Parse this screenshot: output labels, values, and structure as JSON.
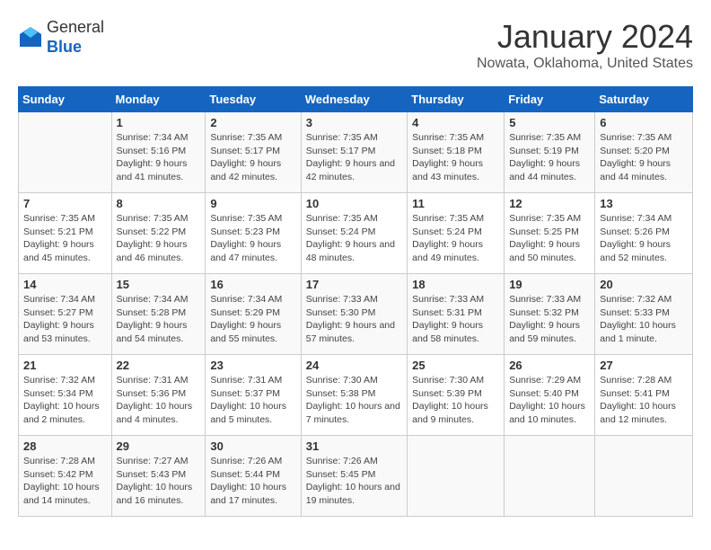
{
  "logo": {
    "general": "General",
    "blue": "Blue"
  },
  "title": "January 2024",
  "subtitle": "Nowata, Oklahoma, United States",
  "weekdays": [
    "Sunday",
    "Monday",
    "Tuesday",
    "Wednesday",
    "Thursday",
    "Friday",
    "Saturday"
  ],
  "weeks": [
    [
      {
        "day": "",
        "sunrise": "",
        "sunset": "",
        "daylight": ""
      },
      {
        "day": "1",
        "sunrise": "Sunrise: 7:34 AM",
        "sunset": "Sunset: 5:16 PM",
        "daylight": "Daylight: 9 hours and 41 minutes."
      },
      {
        "day": "2",
        "sunrise": "Sunrise: 7:35 AM",
        "sunset": "Sunset: 5:17 PM",
        "daylight": "Daylight: 9 hours and 42 minutes."
      },
      {
        "day": "3",
        "sunrise": "Sunrise: 7:35 AM",
        "sunset": "Sunset: 5:17 PM",
        "daylight": "Daylight: 9 hours and 42 minutes."
      },
      {
        "day": "4",
        "sunrise": "Sunrise: 7:35 AM",
        "sunset": "Sunset: 5:18 PM",
        "daylight": "Daylight: 9 hours and 43 minutes."
      },
      {
        "day": "5",
        "sunrise": "Sunrise: 7:35 AM",
        "sunset": "Sunset: 5:19 PM",
        "daylight": "Daylight: 9 hours and 44 minutes."
      },
      {
        "day": "6",
        "sunrise": "Sunrise: 7:35 AM",
        "sunset": "Sunset: 5:20 PM",
        "daylight": "Daylight: 9 hours and 44 minutes."
      }
    ],
    [
      {
        "day": "7",
        "sunrise": "Sunrise: 7:35 AM",
        "sunset": "Sunset: 5:21 PM",
        "daylight": "Daylight: 9 hours and 45 minutes."
      },
      {
        "day": "8",
        "sunrise": "Sunrise: 7:35 AM",
        "sunset": "Sunset: 5:22 PM",
        "daylight": "Daylight: 9 hours and 46 minutes."
      },
      {
        "day": "9",
        "sunrise": "Sunrise: 7:35 AM",
        "sunset": "Sunset: 5:23 PM",
        "daylight": "Daylight: 9 hours and 47 minutes."
      },
      {
        "day": "10",
        "sunrise": "Sunrise: 7:35 AM",
        "sunset": "Sunset: 5:24 PM",
        "daylight": "Daylight: 9 hours and 48 minutes."
      },
      {
        "day": "11",
        "sunrise": "Sunrise: 7:35 AM",
        "sunset": "Sunset: 5:24 PM",
        "daylight": "Daylight: 9 hours and 49 minutes."
      },
      {
        "day": "12",
        "sunrise": "Sunrise: 7:35 AM",
        "sunset": "Sunset: 5:25 PM",
        "daylight": "Daylight: 9 hours and 50 minutes."
      },
      {
        "day": "13",
        "sunrise": "Sunrise: 7:34 AM",
        "sunset": "Sunset: 5:26 PM",
        "daylight": "Daylight: 9 hours and 52 minutes."
      }
    ],
    [
      {
        "day": "14",
        "sunrise": "Sunrise: 7:34 AM",
        "sunset": "Sunset: 5:27 PM",
        "daylight": "Daylight: 9 hours and 53 minutes."
      },
      {
        "day": "15",
        "sunrise": "Sunrise: 7:34 AM",
        "sunset": "Sunset: 5:28 PM",
        "daylight": "Daylight: 9 hours and 54 minutes."
      },
      {
        "day": "16",
        "sunrise": "Sunrise: 7:34 AM",
        "sunset": "Sunset: 5:29 PM",
        "daylight": "Daylight: 9 hours and 55 minutes."
      },
      {
        "day": "17",
        "sunrise": "Sunrise: 7:33 AM",
        "sunset": "Sunset: 5:30 PM",
        "daylight": "Daylight: 9 hours and 57 minutes."
      },
      {
        "day": "18",
        "sunrise": "Sunrise: 7:33 AM",
        "sunset": "Sunset: 5:31 PM",
        "daylight": "Daylight: 9 hours and 58 minutes."
      },
      {
        "day": "19",
        "sunrise": "Sunrise: 7:33 AM",
        "sunset": "Sunset: 5:32 PM",
        "daylight": "Daylight: 9 hours and 59 minutes."
      },
      {
        "day": "20",
        "sunrise": "Sunrise: 7:32 AM",
        "sunset": "Sunset: 5:33 PM",
        "daylight": "Daylight: 10 hours and 1 minute."
      }
    ],
    [
      {
        "day": "21",
        "sunrise": "Sunrise: 7:32 AM",
        "sunset": "Sunset: 5:34 PM",
        "daylight": "Daylight: 10 hours and 2 minutes."
      },
      {
        "day": "22",
        "sunrise": "Sunrise: 7:31 AM",
        "sunset": "Sunset: 5:36 PM",
        "daylight": "Daylight: 10 hours and 4 minutes."
      },
      {
        "day": "23",
        "sunrise": "Sunrise: 7:31 AM",
        "sunset": "Sunset: 5:37 PM",
        "daylight": "Daylight: 10 hours and 5 minutes."
      },
      {
        "day": "24",
        "sunrise": "Sunrise: 7:30 AM",
        "sunset": "Sunset: 5:38 PM",
        "daylight": "Daylight: 10 hours and 7 minutes."
      },
      {
        "day": "25",
        "sunrise": "Sunrise: 7:30 AM",
        "sunset": "Sunset: 5:39 PM",
        "daylight": "Daylight: 10 hours and 9 minutes."
      },
      {
        "day": "26",
        "sunrise": "Sunrise: 7:29 AM",
        "sunset": "Sunset: 5:40 PM",
        "daylight": "Daylight: 10 hours and 10 minutes."
      },
      {
        "day": "27",
        "sunrise": "Sunrise: 7:28 AM",
        "sunset": "Sunset: 5:41 PM",
        "daylight": "Daylight: 10 hours and 12 minutes."
      }
    ],
    [
      {
        "day": "28",
        "sunrise": "Sunrise: 7:28 AM",
        "sunset": "Sunset: 5:42 PM",
        "daylight": "Daylight: 10 hours and 14 minutes."
      },
      {
        "day": "29",
        "sunrise": "Sunrise: 7:27 AM",
        "sunset": "Sunset: 5:43 PM",
        "daylight": "Daylight: 10 hours and 16 minutes."
      },
      {
        "day": "30",
        "sunrise": "Sunrise: 7:26 AM",
        "sunset": "Sunset: 5:44 PM",
        "daylight": "Daylight: 10 hours and 17 minutes."
      },
      {
        "day": "31",
        "sunrise": "Sunrise: 7:26 AM",
        "sunset": "Sunset: 5:45 PM",
        "daylight": "Daylight: 10 hours and 19 minutes."
      },
      {
        "day": "",
        "sunrise": "",
        "sunset": "",
        "daylight": ""
      },
      {
        "day": "",
        "sunrise": "",
        "sunset": "",
        "daylight": ""
      },
      {
        "day": "",
        "sunrise": "",
        "sunset": "",
        "daylight": ""
      }
    ]
  ]
}
